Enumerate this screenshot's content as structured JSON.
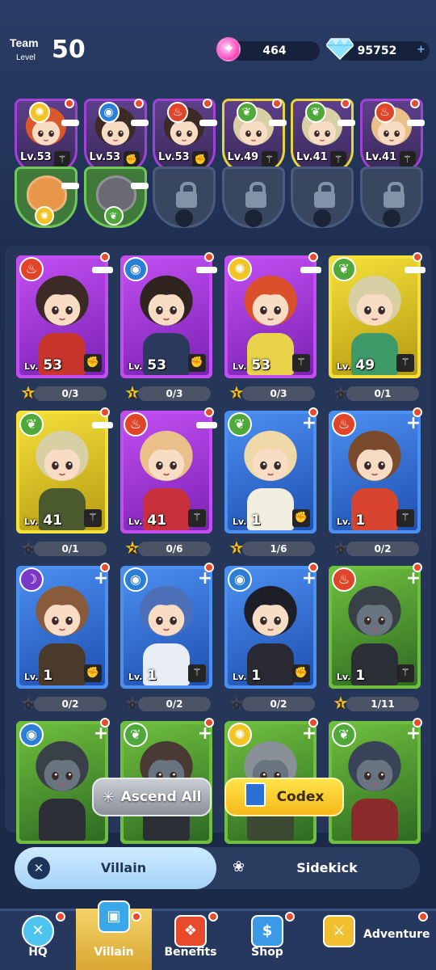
{
  "header": {
    "team_label": "Team",
    "team_sub": "Level",
    "team_level": "50",
    "pink_gems": "464",
    "diamonds": "95752",
    "add": "+"
  },
  "team_slots": [
    {
      "level": "Lv.53",
      "element": "light",
      "weapon": "wand",
      "hair": "#d9582c",
      "frame": "#a340d8"
    },
    {
      "level": "Lv.53",
      "element": "water",
      "weapon": "fist",
      "hair": "#3b2a26",
      "frame": "#a340d8"
    },
    {
      "level": "Lv.53",
      "element": "fire",
      "weapon": "fist",
      "hair": "#3b2a26",
      "frame": "#a340d8"
    },
    {
      "level": "Lv.49",
      "element": "leaf",
      "weapon": "wand",
      "hair": "#d8d0a4",
      "frame": "#e8d43a"
    },
    {
      "level": "Lv.41",
      "element": "leaf",
      "weapon": "wand",
      "hair": "#d8d0a4",
      "frame": "#e8d43a"
    },
    {
      "level": "Lv.41",
      "element": "fire",
      "weapon": "wand",
      "hair": "#e9c08a",
      "frame": "#a340d8"
    }
  ],
  "pets": [
    {
      "state": "active",
      "element": "light",
      "animal": "corgi"
    },
    {
      "state": "active",
      "element": "leaf",
      "animal": "raccoon"
    },
    {
      "state": "locked"
    },
    {
      "state": "locked"
    },
    {
      "state": "locked"
    },
    {
      "state": "locked"
    }
  ],
  "cards": [
    {
      "element": "fire",
      "rarity": "purple",
      "level": "53",
      "weapon": "fist",
      "stars": "1",
      "progress": "0/3",
      "op": "minus",
      "hair": "#3b2a26",
      "outfit": "#c8352c"
    },
    {
      "element": "water",
      "rarity": "purple",
      "level": "53",
      "weapon": "fist",
      "stars": "1",
      "progress": "0/3",
      "op": "minus",
      "hair": "#2f2420",
      "outfit": "#2c3a5e"
    },
    {
      "element": "light",
      "rarity": "purple",
      "level": "53",
      "weapon": "wand",
      "stars": "1",
      "progress": "0/3",
      "op": "minus",
      "hair": "#d9502a",
      "outfit": "#e9d34a"
    },
    {
      "element": "leaf",
      "rarity": "gold",
      "level": "49",
      "weapon": "wand",
      "stars": "0",
      "progress": "0/1",
      "op": "minus",
      "hair": "#d8d0a4",
      "outfit": "#3f9a6a"
    },
    {
      "element": "leaf",
      "rarity": "gold",
      "level": "41",
      "weapon": "wand",
      "stars": "0",
      "progress": "0/1",
      "op": "minus",
      "hair": "#d8d0a4",
      "outfit": "#4a5a2e"
    },
    {
      "element": "fire",
      "rarity": "purple",
      "level": "41",
      "weapon": "wand",
      "stars": "2",
      "progress": "0/6",
      "op": "minus",
      "hair": "#e9c08a",
      "outfit": "#c8303c"
    },
    {
      "element": "leaf",
      "rarity": "blue",
      "level": "1",
      "weapon": "fist",
      "stars": "1",
      "progress": "1/6",
      "op": "plus",
      "hair": "#f0d9a8",
      "outfit": "#f2eee0"
    },
    {
      "element": "fire",
      "rarity": "blue",
      "level": "1",
      "weapon": "wand",
      "stars": "0",
      "progress": "0/2",
      "op": "plus",
      "hair": "#7a4a2c",
      "outfit": "#d8442e"
    },
    {
      "element": "dark",
      "rarity": "blue",
      "level": "1",
      "weapon": "fist",
      "stars": "0",
      "progress": "0/2",
      "op": "plus",
      "hair": "#8a5a3c",
      "outfit": "#4a3a2c"
    },
    {
      "element": "water",
      "rarity": "blue",
      "level": "1",
      "weapon": "wand",
      "stars": "0",
      "progress": "0/2",
      "op": "plus",
      "hair": "#4d6fb8",
      "outfit": "#e8eef4"
    },
    {
      "element": "water",
      "rarity": "blue",
      "level": "1",
      "weapon": "fist",
      "stars": "0",
      "progress": "0/2",
      "op": "plus",
      "hair": "#1e1e28",
      "outfit": "#2a2a34"
    },
    {
      "element": "fire",
      "rarity": "green",
      "level": "1",
      "weapon": "wand",
      "stars": "1",
      "progress": "1/11",
      "op": "plus",
      "hair": "#3a4048",
      "outfit": "#2c3036"
    },
    {
      "element": "water",
      "rarity": "green",
      "level": "",
      "weapon": "",
      "stars": "",
      "progress": "",
      "op": "plus",
      "hair": "#3a4048",
      "outfit": "#2c3036"
    },
    {
      "element": "leaf",
      "rarity": "green",
      "level": "",
      "weapon": "",
      "stars": "",
      "progress": "",
      "op": "plus",
      "hair": "#4a3a34",
      "outfit": "#2c3036"
    },
    {
      "element": "light",
      "rarity": "green",
      "level": "",
      "weapon": "",
      "stars": "",
      "progress": "",
      "op": "plus",
      "hair": "#8a9098",
      "outfit": "#3c4a34"
    },
    {
      "element": "leaf",
      "rarity": "green",
      "level": "",
      "weapon": "",
      "stars": "",
      "progress": "",
      "op": "plus",
      "hair": "#3a4458",
      "outfit": "#8a2a2a"
    }
  ],
  "buttons": {
    "ascend_all": "Ascend All",
    "codex": "Codex"
  },
  "tabs": {
    "villain": "Villain",
    "sidekick": "Sidekick"
  },
  "nav": [
    {
      "label": "HQ",
      "icon": "hq-icon"
    },
    {
      "label": "Villain",
      "icon": "villain-cards-icon"
    },
    {
      "label": "Benefits",
      "icon": "gift-icon"
    },
    {
      "label": "Shop",
      "icon": "shop-icon"
    },
    {
      "label": "Adventure",
      "icon": "crossed-swords-icon"
    }
  ],
  "colors": {
    "fire": "#e0452a",
    "water": "#2c7ed6",
    "light": "#f3c425",
    "leaf": "#4ea83a",
    "dark": "#7a38c8",
    "purple": "#a340d8",
    "gold": "#e8d43a",
    "blue": "#2f6ad8",
    "green": "#5aa83a"
  }
}
